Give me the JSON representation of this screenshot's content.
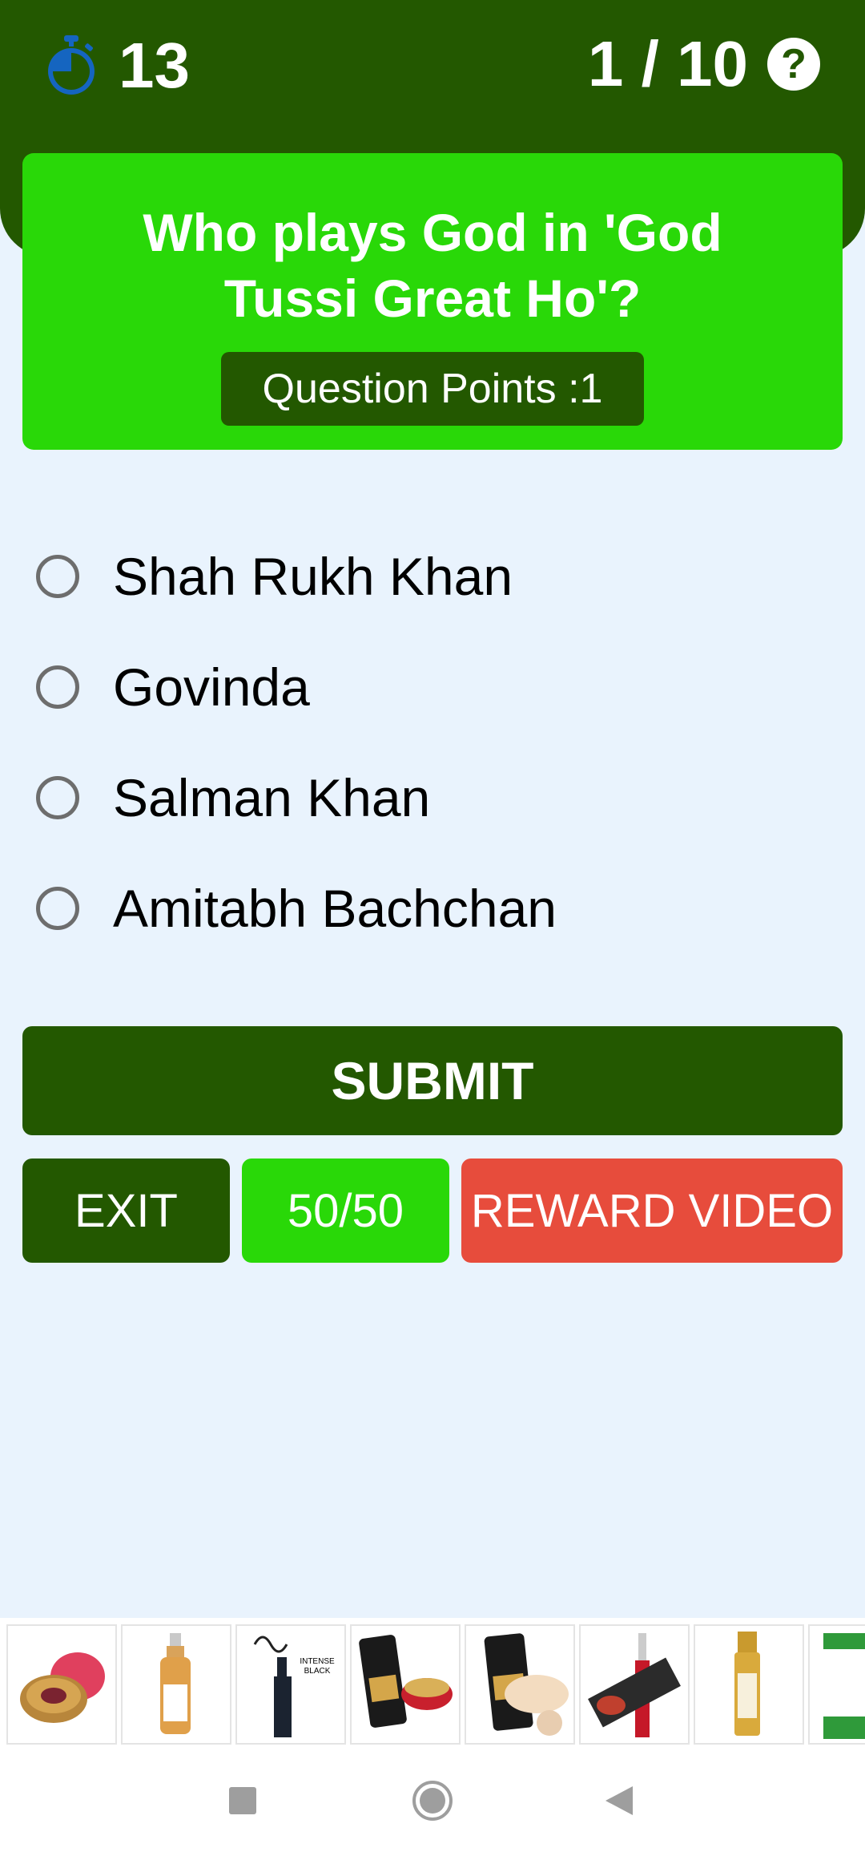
{
  "header": {
    "timer_value": "13",
    "progress": "1 / 10",
    "help_icon": "question-circle-icon",
    "timer_icon": "stopwatch-icon"
  },
  "question": {
    "text": "Who plays God in 'God Tussi Great Ho'?",
    "points_label": "Question Points :1"
  },
  "options": [
    {
      "label": "Shah Rukh Khan",
      "selected": false
    },
    {
      "label": "Govinda",
      "selected": false
    },
    {
      "label": "Salman Khan",
      "selected": false
    },
    {
      "label": "Amitabh Bachchan",
      "selected": false
    }
  ],
  "buttons": {
    "submit": "SUBMIT",
    "exit": "EXIT",
    "fifty_fifty": "50/50",
    "reward_video": "REWARD VIDEO"
  },
  "ad_strip": {
    "items": [
      "lip-balm-product",
      "face-serum-bottle",
      "eyeliner-product",
      "bb-cream-and-lip-product",
      "bb-cream-tube",
      "lipstick-product",
      "serum-pump-bottle",
      "brightening-gel-product"
    ]
  },
  "navbar": {
    "items": [
      "recents-square-icon",
      "home-circle-icon",
      "back-triangle-icon"
    ]
  },
  "colors": {
    "dark_green": "#235800",
    "bright_green": "#29d808",
    "red": "#e74c3c",
    "background": "#e9f3fd",
    "timer_blue": "#1565c0"
  }
}
